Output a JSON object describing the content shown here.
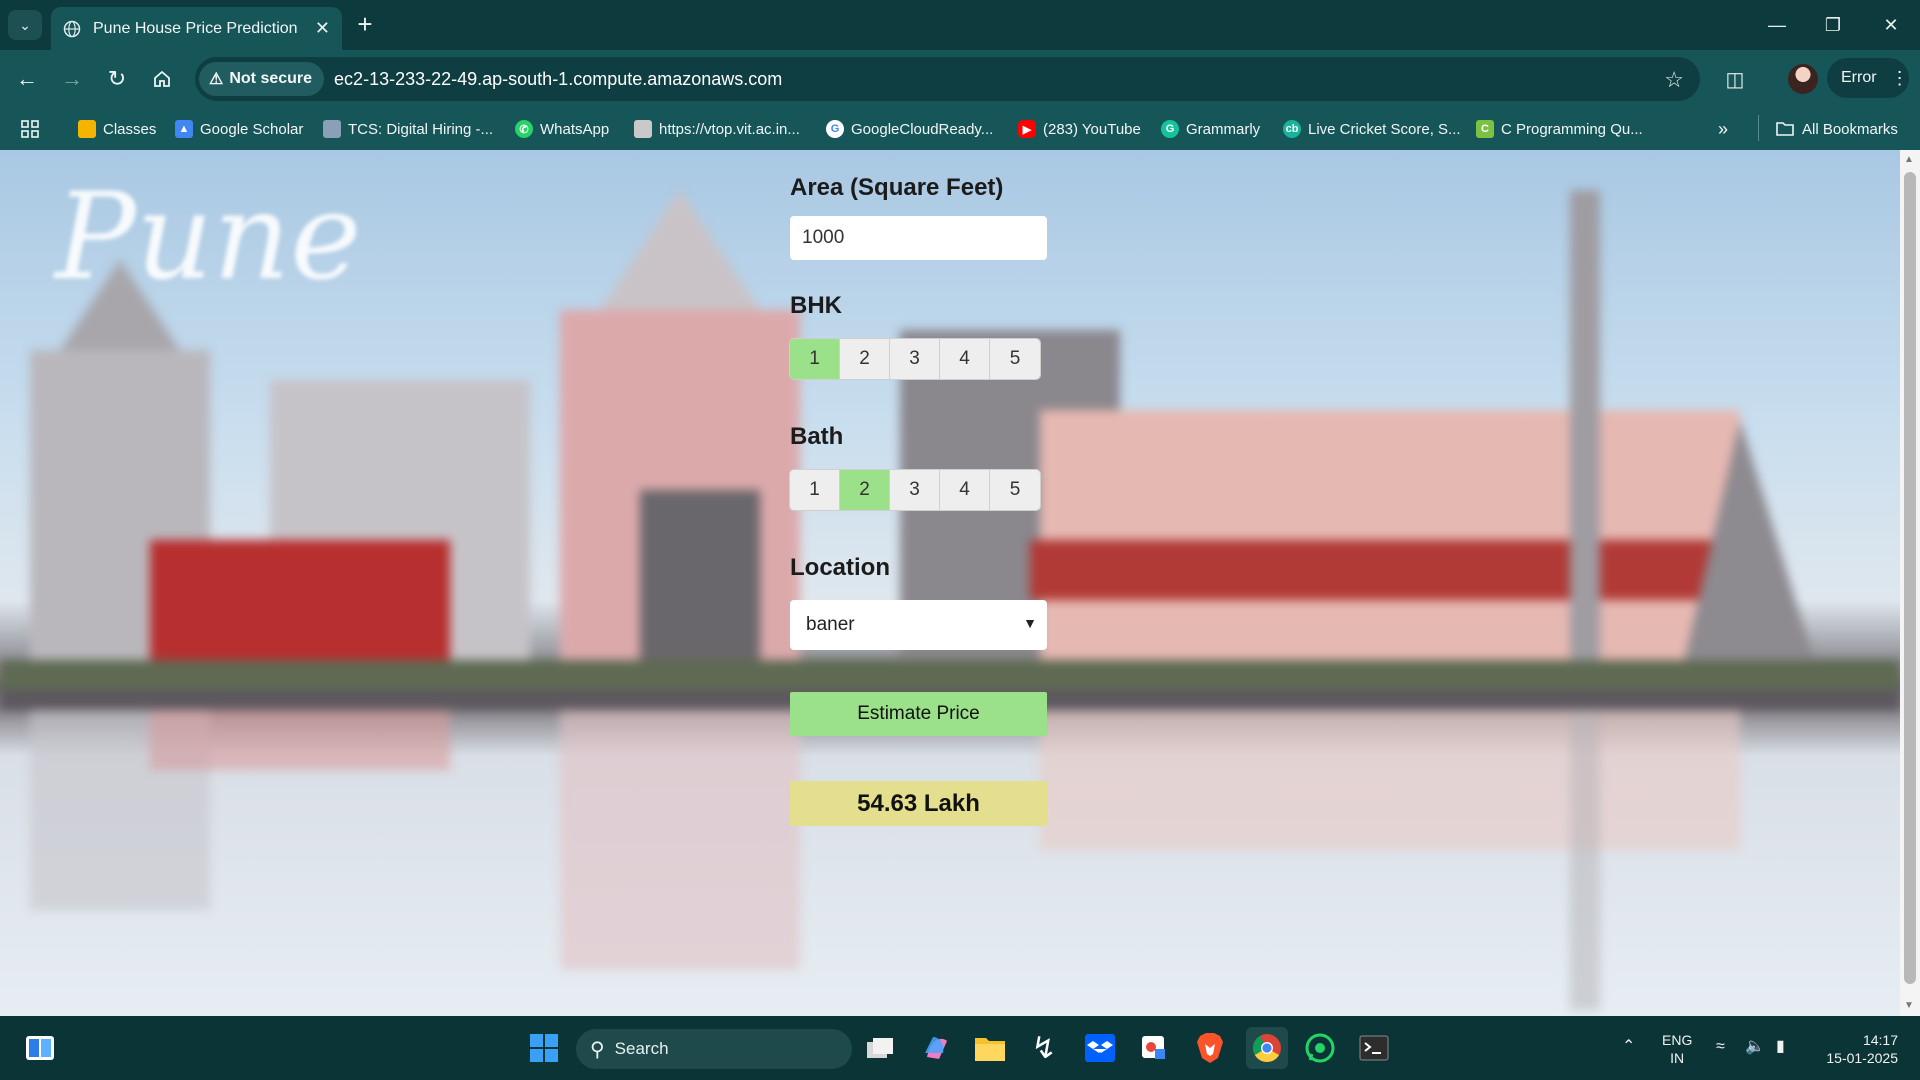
{
  "browser": {
    "tab_title": "Pune House Price Prediction",
    "address": {
      "security_label": "Not secure",
      "url": "ec2-13-233-22-49.ap-south-1.compute.amazonaws.com"
    },
    "profile_status": "Error",
    "bookmarks": [
      {
        "label": "Classes",
        "icon": "classroom-icon",
        "color": "#f5b400"
      },
      {
        "label": "Google Scholar",
        "icon": "scholar-icon",
        "color": "#4285f4"
      },
      {
        "label": "TCS: Digital Hiring -...",
        "icon": "tcs-icon",
        "color": "#8aa0b8"
      },
      {
        "label": "WhatsApp",
        "icon": "whatsapp-icon",
        "color": "#25d366"
      },
      {
        "label": "https://vtop.vit.ac.in...",
        "icon": "vtop-icon",
        "color": "#c9c9c9"
      },
      {
        "label": "GoogleCloudReady...",
        "icon": "google-icon",
        "color": "#ffffff"
      },
      {
        "label": "(283) YouTube",
        "icon": "youtube-icon",
        "color": "#ff0000"
      },
      {
        "label": "Grammarly",
        "icon": "grammarly-icon",
        "color": "#15c39a"
      },
      {
        "label": "Live Cricket Score, S...",
        "icon": "cricket-icon",
        "color": "#17b39b"
      },
      {
        "label": "C Programming Qu...",
        "icon": "c-programming-icon",
        "color": "#7cc242"
      }
    ],
    "all_bookmarks": "All Bookmarks"
  },
  "page": {
    "hero_text": "Pune",
    "form": {
      "area_label": "Area (Square Feet)",
      "area_value": "1000",
      "bhk_label": "BHK",
      "bhk_options": [
        "1",
        "2",
        "3",
        "4",
        "5"
      ],
      "bhk_selected": "1",
      "bath_label": "Bath",
      "bath_options": [
        "1",
        "2",
        "3",
        "4",
        "5"
      ],
      "bath_selected": "2",
      "location_label": "Location",
      "location_value": "baner",
      "estimate_button": "Estimate Price",
      "result": "54.63 Lakh"
    }
  },
  "taskbar": {
    "search_label": "Search",
    "language": "ENG",
    "region": "IN",
    "time": "14:17",
    "date": "15-01-2025"
  }
}
